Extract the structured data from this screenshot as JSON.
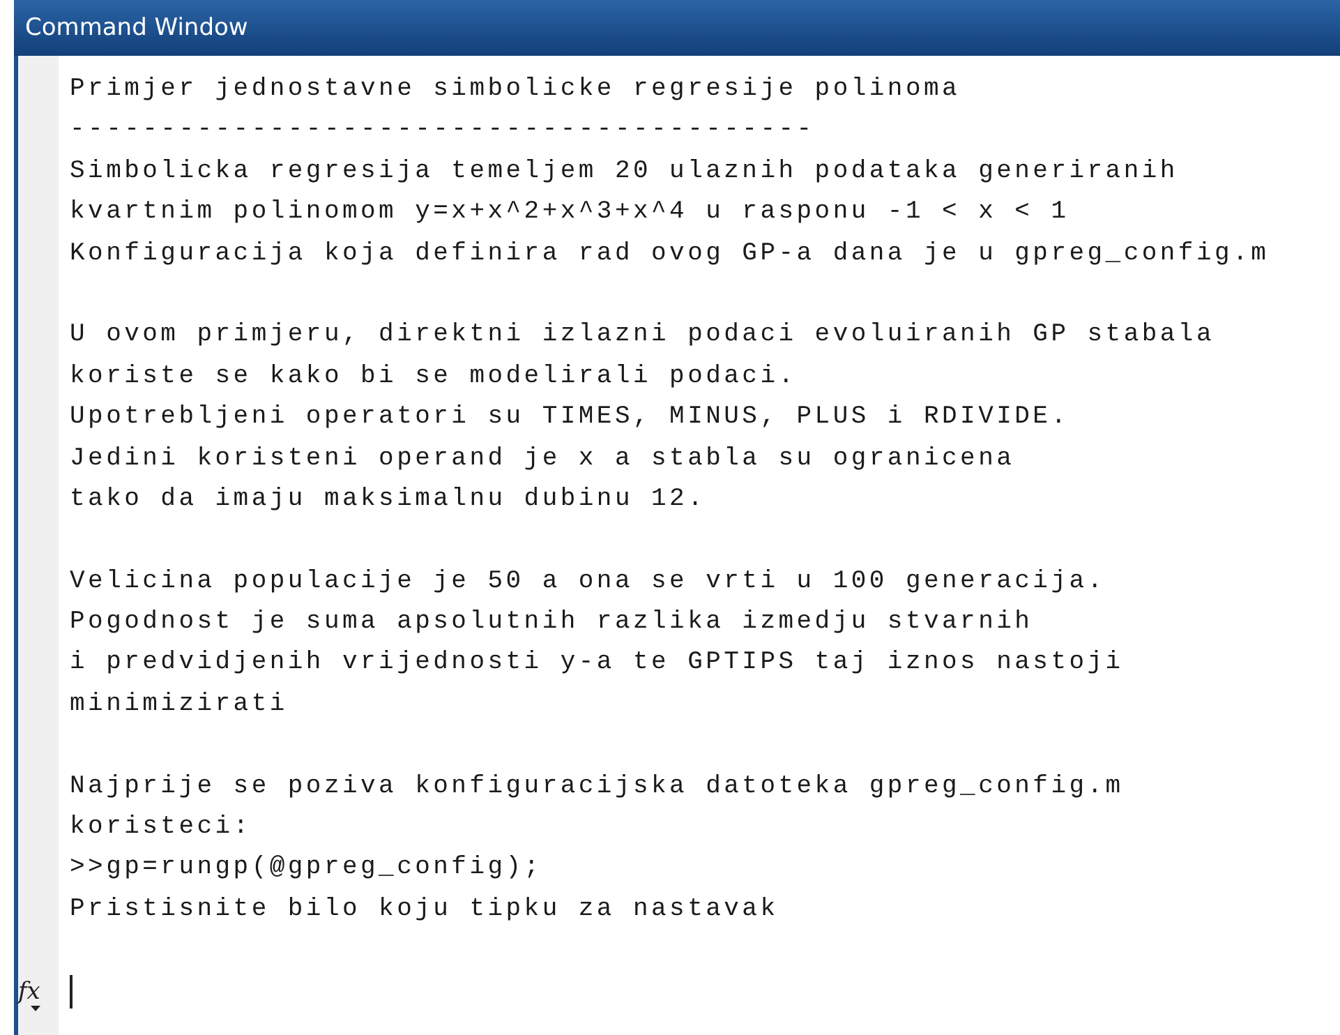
{
  "window": {
    "title": "Command Window"
  },
  "output_blocks": [
    [
      "Primjer jednostavne simbolicke regresije polinoma",
      "-----------------------------------------",
      "Simbolicka regresija temeljem 20 ulaznih podataka generiranih",
      "kvartnim polinomom y=x+x^2+x^3+x^4 u rasponu -1 < x < 1",
      "Konfiguracija koja definira rad ovog GP-a dana je u gpreg_config.m"
    ],
    [
      "U ovom primjeru, direktni izlazni podaci evoluiranih GP stabala",
      "koriste se kako bi se modelirali podaci.",
      "Upotrebljeni operatori su TIMES, MINUS, PLUS i RDIVIDE.",
      "Jedini koristeni operand je x a stabla su ogranicena",
      "tako da imaju maksimalnu dubinu 12."
    ],
    [
      "Velicina populacije je 50 a ona se vrti u 100 generacija.",
      "Pogodnost je suma apsolutnih razlika izmedju stvarnih",
      "i predvidjenih vrijednosti y-a te GPTIPS taj iznos nastoji",
      "minimizirati"
    ],
    [
      "Najprije se poziva konfiguracijska datoteka gpreg_config.m",
      "koristeci:",
      ">>gp=rungp(@gpreg_config);",
      "Pristisnite bilo koju tipku za nastavak"
    ]
  ],
  "prompt": {
    "symbol": "fx"
  }
}
